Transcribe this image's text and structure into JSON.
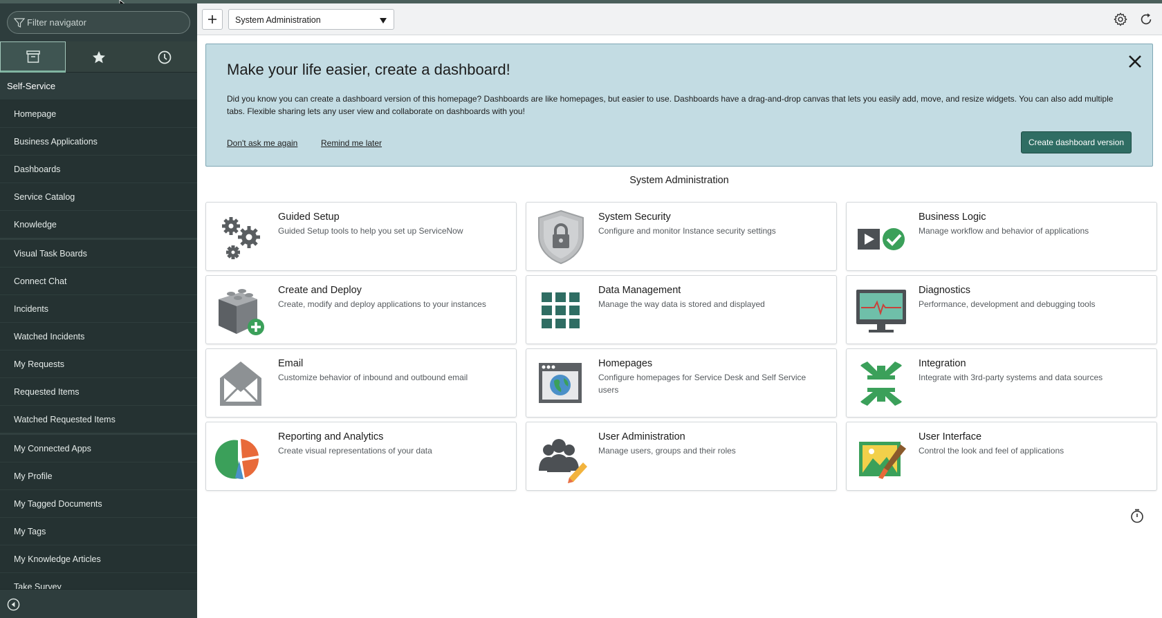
{
  "sidebar": {
    "filter_placeholder": "Filter navigator",
    "tabs": [
      {
        "name": "all-applications-icon",
        "active": true
      },
      {
        "name": "favorites-star-icon",
        "active": false
      },
      {
        "name": "history-clock-icon",
        "active": false
      }
    ],
    "section": "Self-Service",
    "items": [
      "Homepage",
      "Business Applications",
      "Dashboards",
      "Service Catalog",
      "Knowledge",
      "Visual Task Boards",
      "Connect Chat",
      "Incidents",
      "Watched Incidents",
      "My Requests",
      "Requested Items",
      "Watched Requested Items",
      "My Connected Apps",
      "My Profile",
      "My Tagged Documents",
      "My Tags",
      "My Knowledge Articles",
      "Take Survey"
    ]
  },
  "header": {
    "homepage_select": "System Administration"
  },
  "banner": {
    "title": "Make your life easier, create a dashboard!",
    "text": "Did you know you can create a dashboard version of this homepage? Dashboards are like homepages, but easier to use. Dashboards have a drag-and-drop canvas that lets you easily add, move, and resize widgets. You can also add multiple tabs. Flexible sharing lets any user view and collaborate on dashboards with you!",
    "link_dont_ask": "Don't ask me again",
    "link_remind": "Remind me later",
    "cta": "Create dashboard version"
  },
  "section_title": "System Administration",
  "tiles": [
    {
      "name": "Guided Setup",
      "desc": "Guided Setup tools to help you set up ServiceNow"
    },
    {
      "name": "System Security",
      "desc": "Configure and monitor Instance security settings"
    },
    {
      "name": "Business Logic",
      "desc": "Manage workflow and behavior of applications"
    },
    {
      "name": "Create and Deploy",
      "desc": "Create, modify and deploy applications to your instances"
    },
    {
      "name": "Data Management",
      "desc": "Manage the way data is stored and displayed"
    },
    {
      "name": "Diagnostics",
      "desc": "Performance, development and debugging tools"
    },
    {
      "name": "Email",
      "desc": "Customize behavior of inbound and outbound email"
    },
    {
      "name": "Homepages",
      "desc": "Configure homepages for Service Desk and Self Service users"
    },
    {
      "name": "Integration",
      "desc": "Integrate with 3rd-party systems and data sources"
    },
    {
      "name": "Reporting and Analytics",
      "desc": "Create visual representations of your data"
    },
    {
      "name": "User Administration",
      "desc": "Manage users, groups and their roles"
    },
    {
      "name": "User Interface",
      "desc": "Control the look and feel of applications"
    }
  ],
  "colors": {
    "sidebar_bg": "#2e3d3d",
    "banner_bg": "#c3dce3",
    "cta_bg": "#2f6d63",
    "accent": "#81b5a1"
  }
}
